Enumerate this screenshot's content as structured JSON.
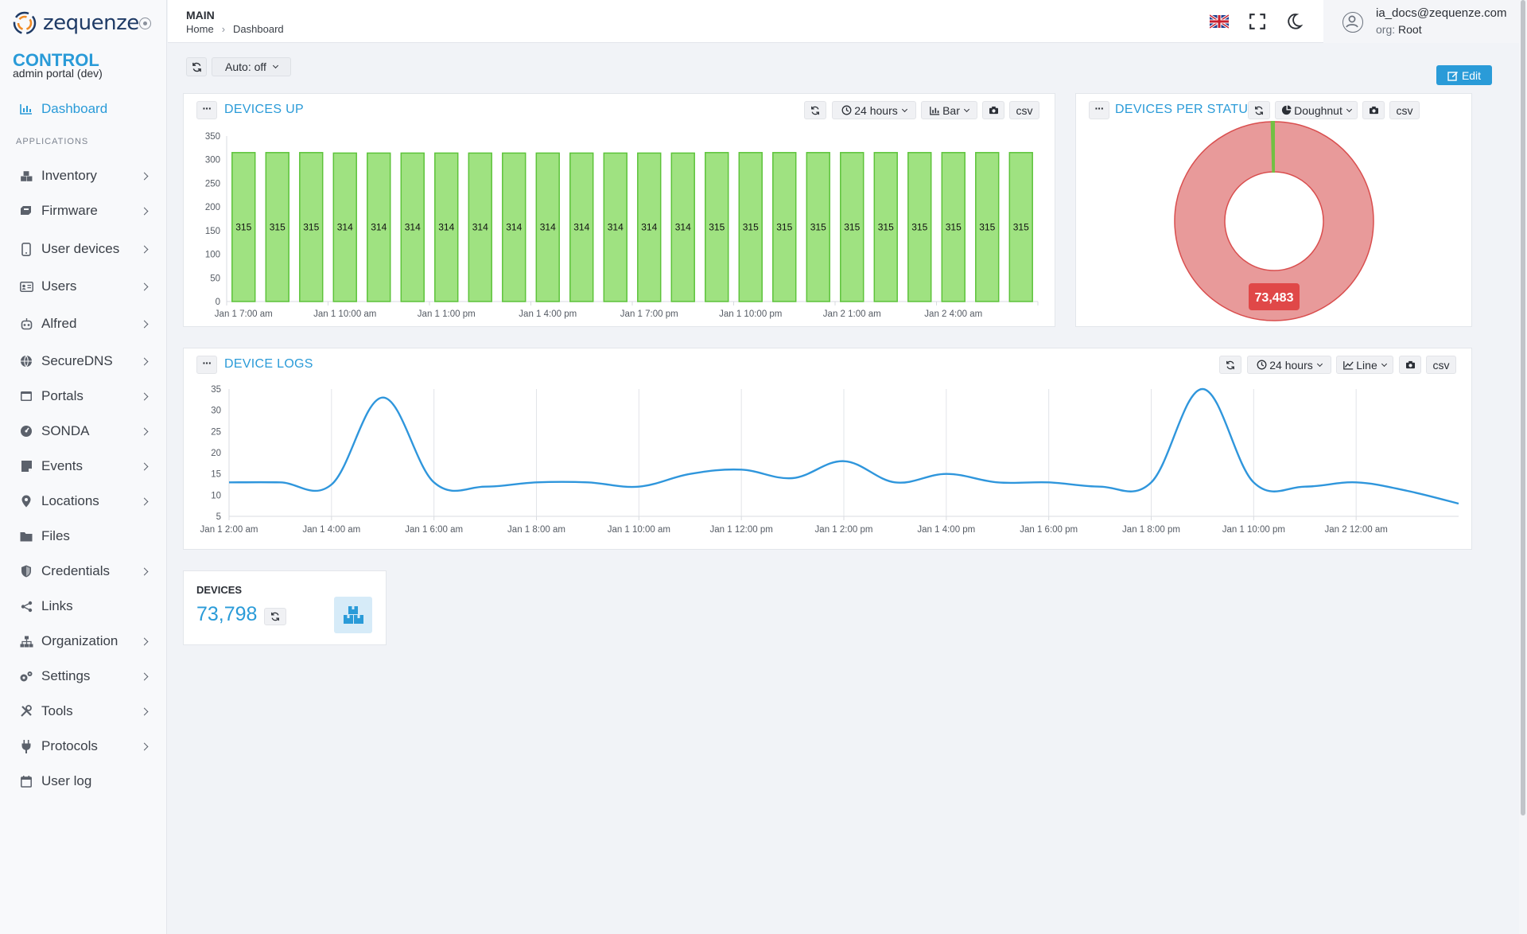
{
  "brand": {
    "logo_text": "zequenze",
    "app_name": "CONTROL",
    "app_subtitle": "admin portal (dev)"
  },
  "sidebar": {
    "section_label": "APPLICATIONS",
    "active": {
      "label": "Dashboard",
      "icon": "bar-chart-icon"
    },
    "items": [
      {
        "label": "Inventory",
        "icon": "boxes-icon",
        "has_submenu": true
      },
      {
        "label": "Firmware",
        "icon": "firmware-icon",
        "has_submenu": true
      },
      {
        "label": "User devices",
        "icon": "mobile-icon",
        "has_submenu": true
      },
      {
        "label": "Users",
        "icon": "id-card-icon",
        "has_submenu": true
      },
      {
        "label": "Alfred",
        "icon": "robot-icon",
        "has_submenu": true
      },
      {
        "label": "SecureDNS",
        "icon": "globe-icon",
        "has_submenu": true
      },
      {
        "label": "Portals",
        "icon": "window-icon",
        "has_submenu": true
      },
      {
        "label": "SONDA",
        "icon": "gauge-icon",
        "has_submenu": true
      },
      {
        "label": "Events",
        "icon": "events-icon",
        "has_submenu": true
      },
      {
        "label": "Locations",
        "icon": "map-pin-icon",
        "has_submenu": true
      },
      {
        "label": "Files",
        "icon": "folder-icon",
        "has_submenu": false
      },
      {
        "label": "Credentials",
        "icon": "shield-icon",
        "has_submenu": true
      },
      {
        "label": "Links",
        "icon": "share-icon",
        "has_submenu": false
      },
      {
        "label": "Organization",
        "icon": "sitemap-icon",
        "has_submenu": true
      },
      {
        "label": "Settings",
        "icon": "gears-icon",
        "has_submenu": true
      },
      {
        "label": "Tools",
        "icon": "tools-icon",
        "has_submenu": true
      },
      {
        "label": "Protocols",
        "icon": "plug-icon",
        "has_submenu": true
      },
      {
        "label": "User log",
        "icon": "calendar-icon",
        "has_submenu": false
      }
    ]
  },
  "header": {
    "title": "MAIN",
    "breadcrumb": [
      "Home",
      "Dashboard"
    ],
    "breadcrumb_separator": "›",
    "user_email": "ia_docs@zequenze.com",
    "org_label": "org:",
    "org_value": "Root"
  },
  "toolbar": {
    "auto_refresh": "Auto: off",
    "edit_label": "Edit"
  },
  "colors": {
    "accent": "#2a9bd8",
    "bar_fill": "#9fe281",
    "bar_stroke": "#5dc33a",
    "doughnut_main": "#e89a9a",
    "doughnut_main_stroke": "#d94e4e",
    "doughnut_badge": "#e04848",
    "doughnut_minor": "#72c043",
    "line": "#2f96dc"
  },
  "devices_up": {
    "title": "DEVICES UP",
    "range": "24 hours",
    "chart_type_label": "Bar",
    "csv_label": "csv"
  },
  "devices_per_status": {
    "title": "DEVICES PER STATUS",
    "chart_type_label": "Doughnut",
    "csv_label": "csv"
  },
  "device_logs": {
    "title": "DEVICE LOGS",
    "range": "24 hours",
    "chart_type_label": "Line",
    "csv_label": "csv"
  },
  "devices_kpi": {
    "title": "DEVICES",
    "value": "73,798",
    "icon": "boxes-icon"
  },
  "chart_data": [
    {
      "id": "devices_up",
      "type": "bar",
      "title": "DEVICES UP",
      "ylim": [
        0,
        350
      ],
      "yticks": [
        0,
        50,
        100,
        150,
        200,
        250,
        300,
        350
      ],
      "x_tick_labels": [
        "Jan 1 7:00 am",
        "Jan 1 10:00 am",
        "Jan 1 1:00 pm",
        "Jan 1 4:00 pm",
        "Jan 1 7:00 pm",
        "Jan 1 10:00 pm",
        "Jan 2 1:00 am",
        "Jan 2 4:00 am"
      ],
      "values": [
        315,
        315,
        315,
        314,
        314,
        314,
        314,
        314,
        314,
        314,
        314,
        314,
        314,
        314,
        315,
        315,
        315,
        315,
        315,
        315,
        315,
        315,
        315,
        315
      ],
      "data_labels": true
    },
    {
      "id": "devices_per_status",
      "type": "pie",
      "title": "DEVICES PER STATUS",
      "slices": [
        {
          "value": 73483,
          "label": "73,483"
        },
        {
          "value": 315
        }
      ]
    },
    {
      "id": "device_logs",
      "type": "line",
      "title": "DEVICE LOGS",
      "ylim": [
        5,
        35
      ],
      "yticks": [
        5,
        10,
        15,
        20,
        25,
        30,
        35
      ],
      "x_tick_labels": [
        "Jan 1 2:00 am",
        "Jan 1 4:00 am",
        "Jan 1 6:00 am",
        "Jan 1 8:00 am",
        "Jan 1 10:00 am",
        "Jan 1 12:00 pm",
        "Jan 1 2:00 pm",
        "Jan 1 4:00 pm",
        "Jan 1 6:00 pm",
        "Jan 1 8:00 pm",
        "Jan 1 10:00 pm",
        "Jan 2 12:00 am"
      ],
      "x_hours": [
        0,
        1,
        2,
        3,
        4,
        5,
        6,
        7,
        8,
        9,
        10,
        11,
        12,
        13,
        14,
        15,
        16,
        17,
        18,
        19,
        20,
        21,
        22,
        23,
        24
      ],
      "values": [
        13,
        13,
        12.5,
        33,
        13,
        12,
        13,
        13,
        12,
        15,
        16,
        14,
        18,
        13,
        15,
        13,
        13,
        12,
        13,
        35,
        13,
        12,
        13,
        11,
        8
      ]
    }
  ]
}
